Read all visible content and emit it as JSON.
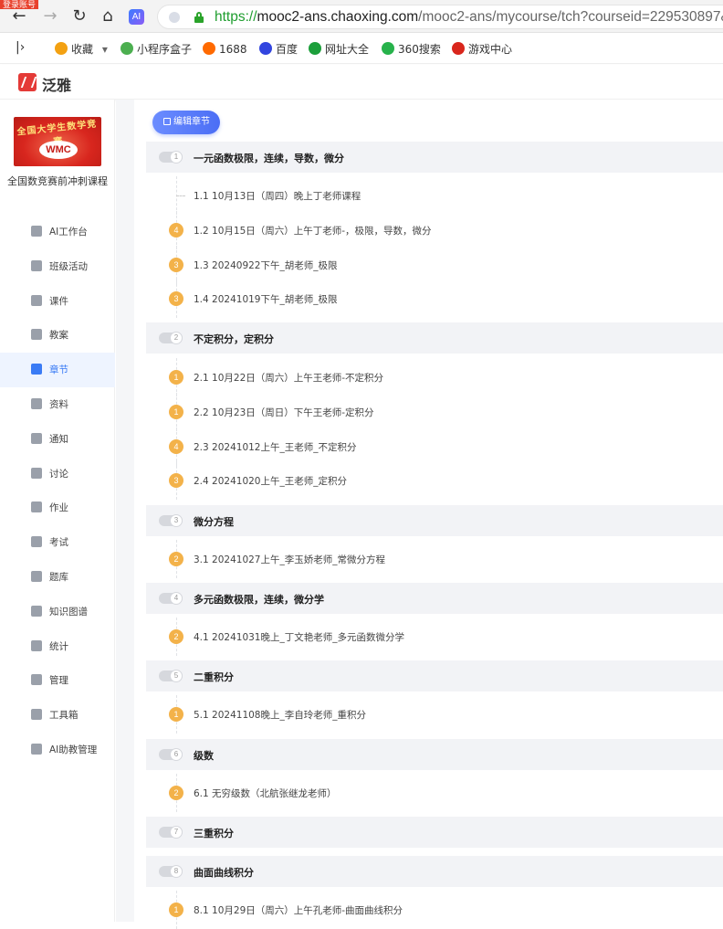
{
  "browser": {
    "rec_badge": "登录账号",
    "url_prefix": "https://",
    "url_host": "mooc2-ans.chaoxing.com",
    "url_path": "/mooc2-ans/mycourse/tch?courseid=229530897&",
    "ai_label": "AI",
    "bookmarks": [
      {
        "label": "收藏",
        "icon": "star-icon",
        "color": "#f3a112"
      },
      {
        "label": "小程序盒子",
        "icon": "shield-icon",
        "color": "#4caf50"
      },
      {
        "label": "1688",
        "icon": "1688-icon",
        "color": "#ff6a00"
      },
      {
        "label": "百度",
        "icon": "paw-icon",
        "color": "#3245df"
      },
      {
        "label": "网址大全",
        "icon": "globe-icon",
        "color": "#1c9f3b"
      },
      {
        "label": "360搜索",
        "icon": "circle-icon",
        "color": "#27b24b"
      },
      {
        "label": "游戏中心",
        "icon": "game-icon",
        "color": "#d9261c"
      }
    ]
  },
  "app": {
    "logo_text": "泛雅"
  },
  "course": {
    "cover_arc": "全国大学生数学竞赛",
    "cover_logo": "WMC",
    "title": "全国数竞赛前冲刺课程"
  },
  "menu": [
    {
      "label": "AI工作台",
      "icon": "ai-workbench-icon",
      "active": false
    },
    {
      "label": "班级活动",
      "icon": "class-activity-icon",
      "active": false
    },
    {
      "label": "课件",
      "icon": "courseware-icon",
      "active": false
    },
    {
      "label": "教案",
      "icon": "lesson-plan-icon",
      "active": false
    },
    {
      "label": "章节",
      "icon": "chapter-icon",
      "active": true
    },
    {
      "label": "资料",
      "icon": "folder-icon",
      "active": false
    },
    {
      "label": "通知",
      "icon": "speaker-icon",
      "active": false
    },
    {
      "label": "讨论",
      "icon": "chat-icon",
      "active": false
    },
    {
      "label": "作业",
      "icon": "homework-icon",
      "active": false
    },
    {
      "label": "考试",
      "icon": "exam-icon",
      "active": false
    },
    {
      "label": "题库",
      "icon": "question-bank-icon",
      "active": false
    },
    {
      "label": "知识图谱",
      "icon": "knowledge-graph-icon",
      "active": false
    },
    {
      "label": "统计",
      "icon": "stats-icon",
      "active": false
    },
    {
      "label": "管理",
      "icon": "settings-icon",
      "active": false
    },
    {
      "label": "工具箱",
      "icon": "toolbox-icon",
      "active": false
    },
    {
      "label": "AI助教管理",
      "icon": "ai-assistant-icon",
      "active": false
    }
  ],
  "edit_button": "编辑章节",
  "chapters": [
    {
      "num": "1",
      "title": "一元函数极限，连续，导数，微分",
      "sections": [
        {
          "badge": "",
          "title": "1.1 10月13日（周四）晚上丁老师课程"
        },
        {
          "badge": "4",
          "title": "1.2 10月15日（周六）上午丁老师-，极限，导数，微分"
        },
        {
          "badge": "3",
          "title": "1.3 20240922下午_胡老师_极限"
        },
        {
          "badge": "3",
          "title": "1.4 20241019下午_胡老师_极限"
        }
      ]
    },
    {
      "num": "2",
      "title": "不定积分，定积分",
      "sections": [
        {
          "badge": "1",
          "title": "2.1 10月22日（周六）上午王老师-不定积分"
        },
        {
          "badge": "1",
          "title": "2.2 10月23日（周日）下午王老师-定积分"
        },
        {
          "badge": "4",
          "title": "2.3 20241012上午_王老师_不定积分"
        },
        {
          "badge": "3",
          "title": "2.4 20241020上午_王老师_定积分"
        }
      ]
    },
    {
      "num": "3",
      "title": "微分方程",
      "sections": [
        {
          "badge": "2",
          "title": "3.1 20241027上午_李玉娇老师_常微分方程"
        }
      ]
    },
    {
      "num": "4",
      "title": "多元函数极限，连续，微分学",
      "sections": [
        {
          "badge": "2",
          "title": "4.1 20241031晚上_丁文艳老师_多元函数微分学"
        }
      ]
    },
    {
      "num": "5",
      "title": "二重积分",
      "sections": [
        {
          "badge": "1",
          "title": "5.1 20241108晚上_李自玲老师_重积分"
        }
      ]
    },
    {
      "num": "6",
      "title": "级数",
      "sections": [
        {
          "badge": "2",
          "title": "6.1 无穷级数（北航张继龙老师）"
        }
      ]
    },
    {
      "num": "7",
      "title": "三重积分",
      "sections": []
    },
    {
      "num": "8",
      "title": "曲面曲线积分",
      "sections": [
        {
          "badge": "1",
          "title": "8.1 10月29日（周六）上午孔老师-曲面曲线积分"
        }
      ]
    }
  ]
}
